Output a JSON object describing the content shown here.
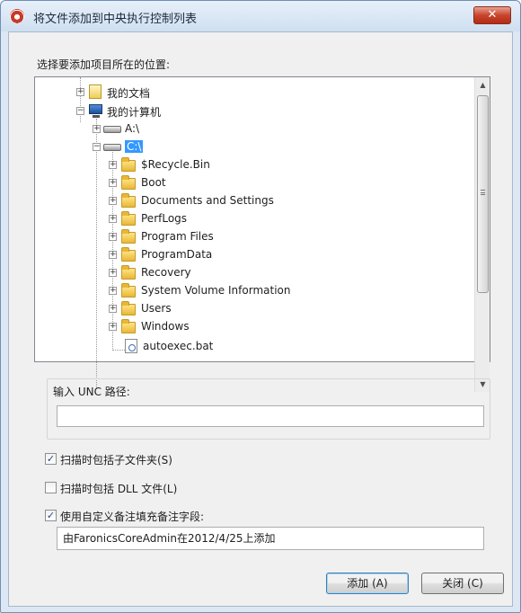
{
  "window": {
    "title": "将文件添加到中央执行控制列表",
    "close_label": "✕"
  },
  "location": {
    "label": "选择要添加项目所在的位置:"
  },
  "tree": {
    "my_documents": "我的文档",
    "my_computer": "我的计算机",
    "drive_a": "A:\\",
    "drive_c": "C:\\",
    "c_children": [
      "$Recycle.Bin",
      "Boot",
      "Documents and Settings",
      "PerfLogs",
      "Program Files",
      "ProgramData",
      "Recovery",
      "System Volume Information",
      "Users",
      "Windows"
    ],
    "file": "autoexec.bat",
    "expanded_glyph": "−",
    "collapsed_glyph": "+"
  },
  "unc": {
    "label": "输入 UNC 路径:",
    "value": ""
  },
  "options": {
    "scan_subfolders": {
      "label": "扫描时包括子文件夹(S)",
      "checked": true
    },
    "scan_dll": {
      "label": "扫描时包括 DLL 文件(L)",
      "checked": false
    },
    "custom_comment": {
      "label": "使用自定义备注填充备注字段:",
      "checked": true
    },
    "check_glyph": "✓"
  },
  "comment": {
    "value": "由FaronicsCoreAdmin在2012/4/25上添加"
  },
  "buttons": {
    "add": "添加 (A)",
    "close": "关闭 (C)"
  },
  "scrollbar": {
    "up_glyph": "▲",
    "down_glyph": "▼"
  }
}
